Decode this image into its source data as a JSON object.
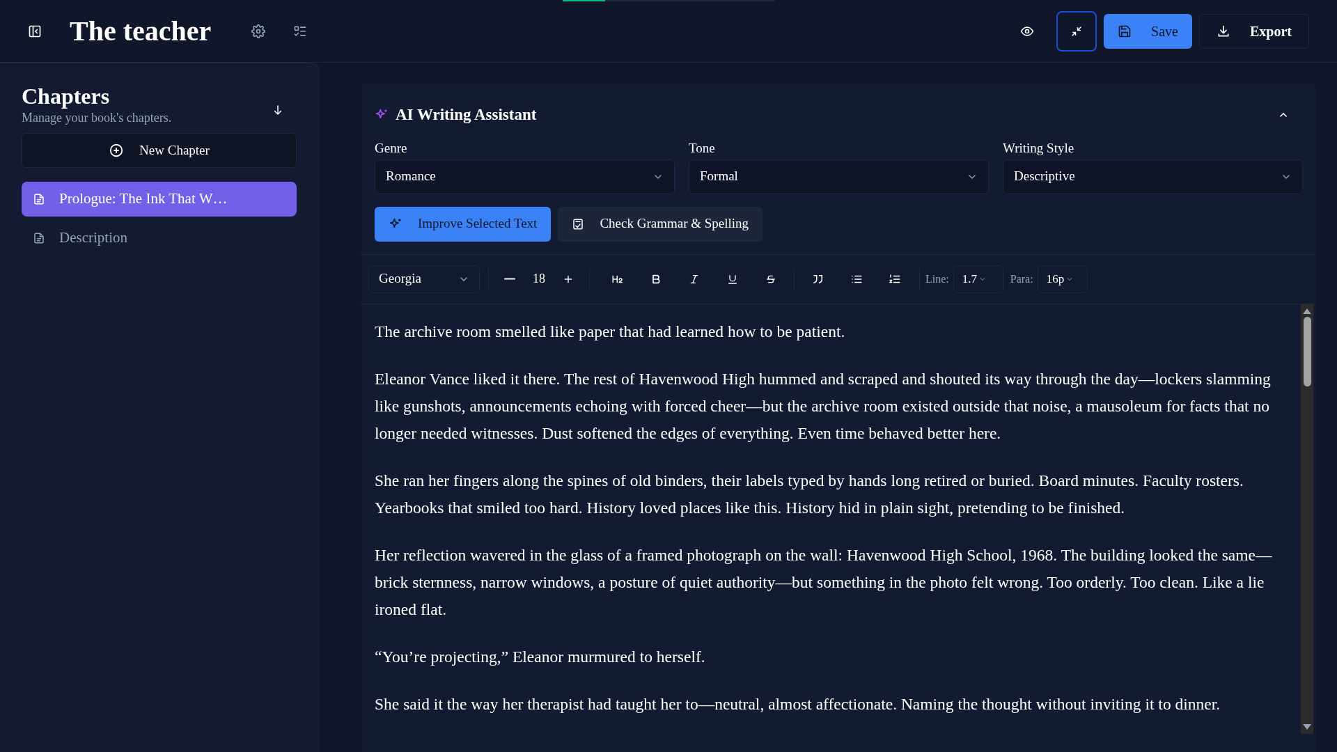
{
  "top_bar": {
    "title": "The teacher",
    "loading": {
      "level": 0.2
    },
    "actions": [
      {
        "kind": "preview",
        "focused": false
      },
      {
        "kind": "focus-mode",
        "focused": true
      },
      {
        "kind": "save",
        "label": "Save"
      },
      {
        "kind": "export",
        "label": "Export"
      }
    ]
  },
  "sidebar": {
    "title": "Chapters",
    "subtitle": "Manage your book's chapters.",
    "new_button": "New Chapter",
    "items": [
      {
        "label": "Prologue: The Ink That W…",
        "selected": true
      },
      {
        "label": "Description",
        "selected": false
      }
    ]
  },
  "assistant": {
    "title": "AI Writing Assistant",
    "expanded": true,
    "selects": [
      {
        "label": "Genre",
        "value": "Romance"
      },
      {
        "label": "Tone",
        "value": "Formal"
      },
      {
        "label": "Writing Style",
        "value": "Descriptive"
      }
    ],
    "buttons": [
      {
        "kind": "improve",
        "label": "Improve Selected Text"
      },
      {
        "kind": "grammar",
        "label": "Check Grammar & Spelling"
      }
    ]
  },
  "toolbar": {
    "font": "Georgia",
    "size": "18",
    "tools": [
      {
        "kind": "heading"
      },
      {
        "kind": "bold"
      },
      {
        "kind": "italic"
      },
      {
        "kind": "underline"
      },
      {
        "kind": "strike"
      },
      {
        "kind": "quote"
      },
      {
        "kind": "bullets"
      },
      {
        "kind": "numbers"
      }
    ],
    "line_label": "Line:",
    "line_value": "1.7",
    "para_label": "Para:",
    "para_value": "16p"
  },
  "editor": {
    "paragraphs": [
      "The archive room smelled like paper that had learned how to be patient.",
      "Eleanor Vance liked it there. The rest of Havenwood High hummed and scraped and shouted its way through the day—lockers slamming like gunshots, announcements echoing with forced cheer—but the archive room existed outside that noise, a mausoleum for facts that no longer needed witnesses. Dust softened the edges of everything. Even time behaved better here.",
      "She ran her fingers along the spines of old binders, their labels typed by hands long retired or buried. Board minutes. Faculty rosters. Yearbooks that smiled too hard. History loved places like this. History hid in plain sight, pretending to be finished.",
      "Her reflection wavered in the glass of a framed photograph on the wall: Havenwood High School, 1968. The building looked the same—brick sternness, narrow windows, a posture of quiet authority—but something in the photo felt wrong. Too orderly. Too clean. Like a lie ironed flat.",
      "“You’re projecting,” Eleanor murmured to herself.",
      "She said it the way her therapist had taught her to—neutral, almost affectionate. Naming the thought without inviting it to dinner."
    ]
  }
}
